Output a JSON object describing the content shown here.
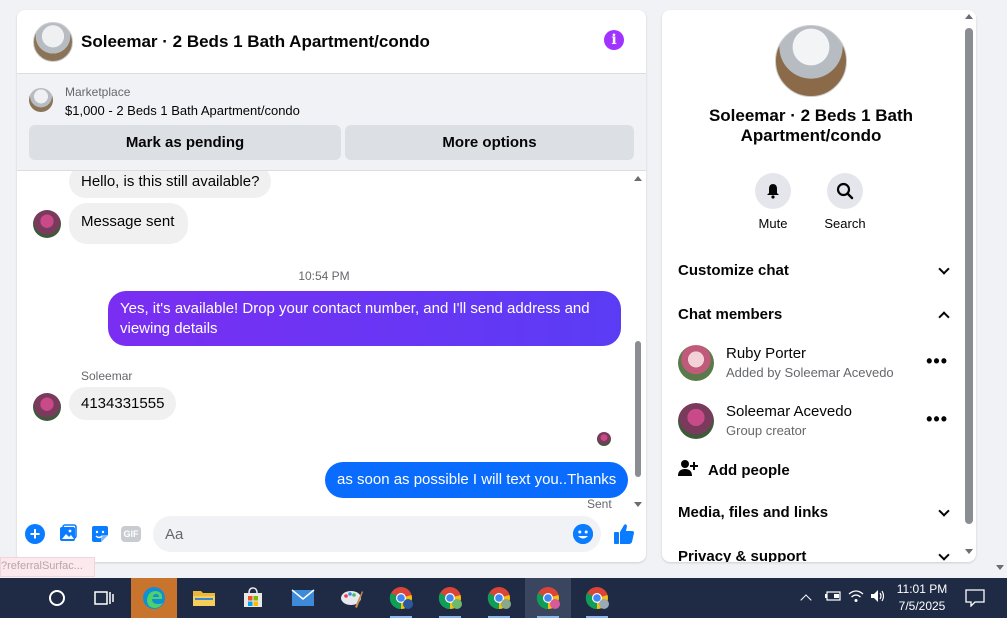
{
  "chat": {
    "title": "Soleemar · 2 Beds 1 Bath Apartment/condo",
    "marketplace_label": "Marketplace",
    "listing": "$1,000 - 2 Beds 1 Bath Apartment/condo",
    "mark_pending_label": "Mark as pending",
    "more_options_label": "More options",
    "messages": {
      "partial_in": "Hello, is this still available?",
      "auto_sent": "Message sent",
      "time": "10:54 PM",
      "out_1": "Yes, it's available! Drop your contact number, and I'll send address and viewing details",
      "sender": "Soleemar",
      "in_number": "4134331555",
      "out_2": "as soon as possible I will text you..Thanks",
      "status": "Sent"
    },
    "composer_placeholder": "Aa",
    "gif_label": "GIF"
  },
  "tooltip": "?referralSurfac...",
  "info": {
    "title": "Soleemar · 2 Beds 1 Bath Apartment/condo",
    "mute_label": "Mute",
    "search_label": "Search",
    "customize_chat": "Customize chat",
    "chat_members": "Chat members",
    "members": [
      {
        "name": "Ruby Porter",
        "sub": "Added by Soleemar Acevedo"
      },
      {
        "name": "Soleemar Acevedo",
        "sub": "Group creator"
      }
    ],
    "add_people": "Add people",
    "media_files_links": "Media, files and links",
    "privacy_support": "Privacy & support"
  },
  "taskbar": {
    "time": "11:01 PM",
    "date": "7/5/2025"
  },
  "colors": {
    "accent_purple": "#a033ff",
    "bubble_gradient_start": "#7a2ef2",
    "bubble_blue": "#0a6cff",
    "messenger_blue": "#0a7cff"
  }
}
